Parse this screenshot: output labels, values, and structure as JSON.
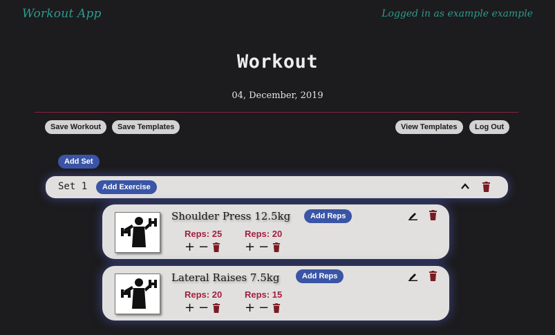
{
  "header": {
    "brand": "Workout App",
    "login_status": "Logged in as example example"
  },
  "workout": {
    "title": "Workout",
    "date": "04, December, 2019"
  },
  "toolbar": {
    "save_workout": "Save Workout",
    "save_templates": "Save Templates",
    "view_templates": "View Templates",
    "log_out": "Log Out"
  },
  "add_set_label": "Add Set",
  "sets": [
    {
      "label": "Set 1",
      "add_exercise_label": "Add Exercise",
      "exercises": [
        {
          "name": "Shoulder Press 12.5kg",
          "add_reps_label": "Add Reps",
          "reps": [
            {
              "label": "Reps: 25"
            },
            {
              "label": "Reps: 20"
            }
          ]
        },
        {
          "name": "Lateral Raises 7.5kg",
          "add_reps_label": "Add Reps",
          "reps": [
            {
              "label": "Reps: 20"
            },
            {
              "label": "Reps: 15"
            }
          ]
        }
      ]
    }
  ],
  "colors": {
    "background": "#1c1b1d",
    "brand_teal": "#2a9d8f",
    "accent_blue": "#3a55a6",
    "reps_red": "#a01f3e",
    "trash_red": "#7a1a22",
    "divider": "#8a2340",
    "card": "#e2e0de"
  },
  "icons": {
    "collapse": "chevron-up-icon",
    "delete": "trash-icon",
    "edit": "pencil-icon",
    "increment": "plus-icon",
    "decrement": "minus-icon",
    "exercise_image": "dumbbell-person-icon"
  }
}
